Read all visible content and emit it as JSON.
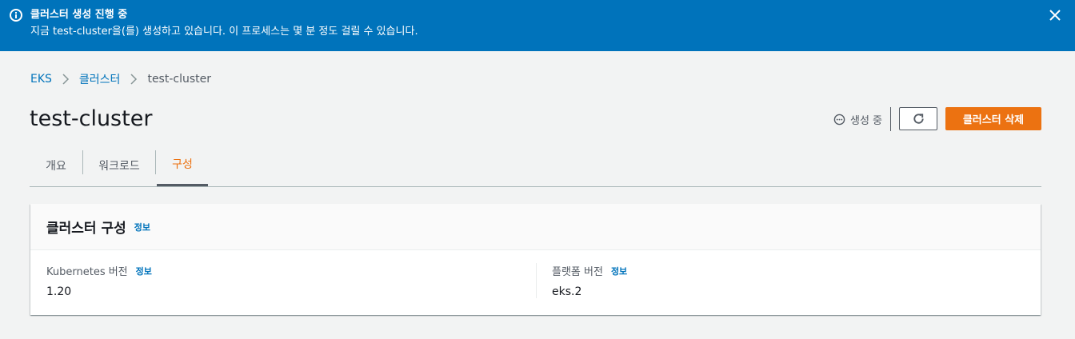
{
  "flash": {
    "title": "클러스터 생성 진행 중",
    "message": "지금 test-cluster을(를) 생성하고 있습니다. 이 프로세스는 몇 분 정도 걸릴 수 있습니다.",
    "color": "#0073bb"
  },
  "breadcrumb": {
    "items": [
      "EKS",
      "클러스터",
      "test-cluster"
    ]
  },
  "header": {
    "title": "test-cluster",
    "status": "생성 중",
    "delete_label": "클러스터 삭제",
    "accent": "#ec7211"
  },
  "tabs": [
    {
      "label": "개요"
    },
    {
      "label": "워크로드"
    },
    {
      "label": "구성",
      "active": true
    }
  ],
  "panel": {
    "title": "클러스터 구성",
    "info": "정보",
    "fields": [
      {
        "label": "Kubernetes 버전",
        "info": "정보",
        "value": "1.20"
      },
      {
        "label": "플랫폼 버전",
        "info": "정보",
        "value": "eks.2"
      }
    ]
  }
}
